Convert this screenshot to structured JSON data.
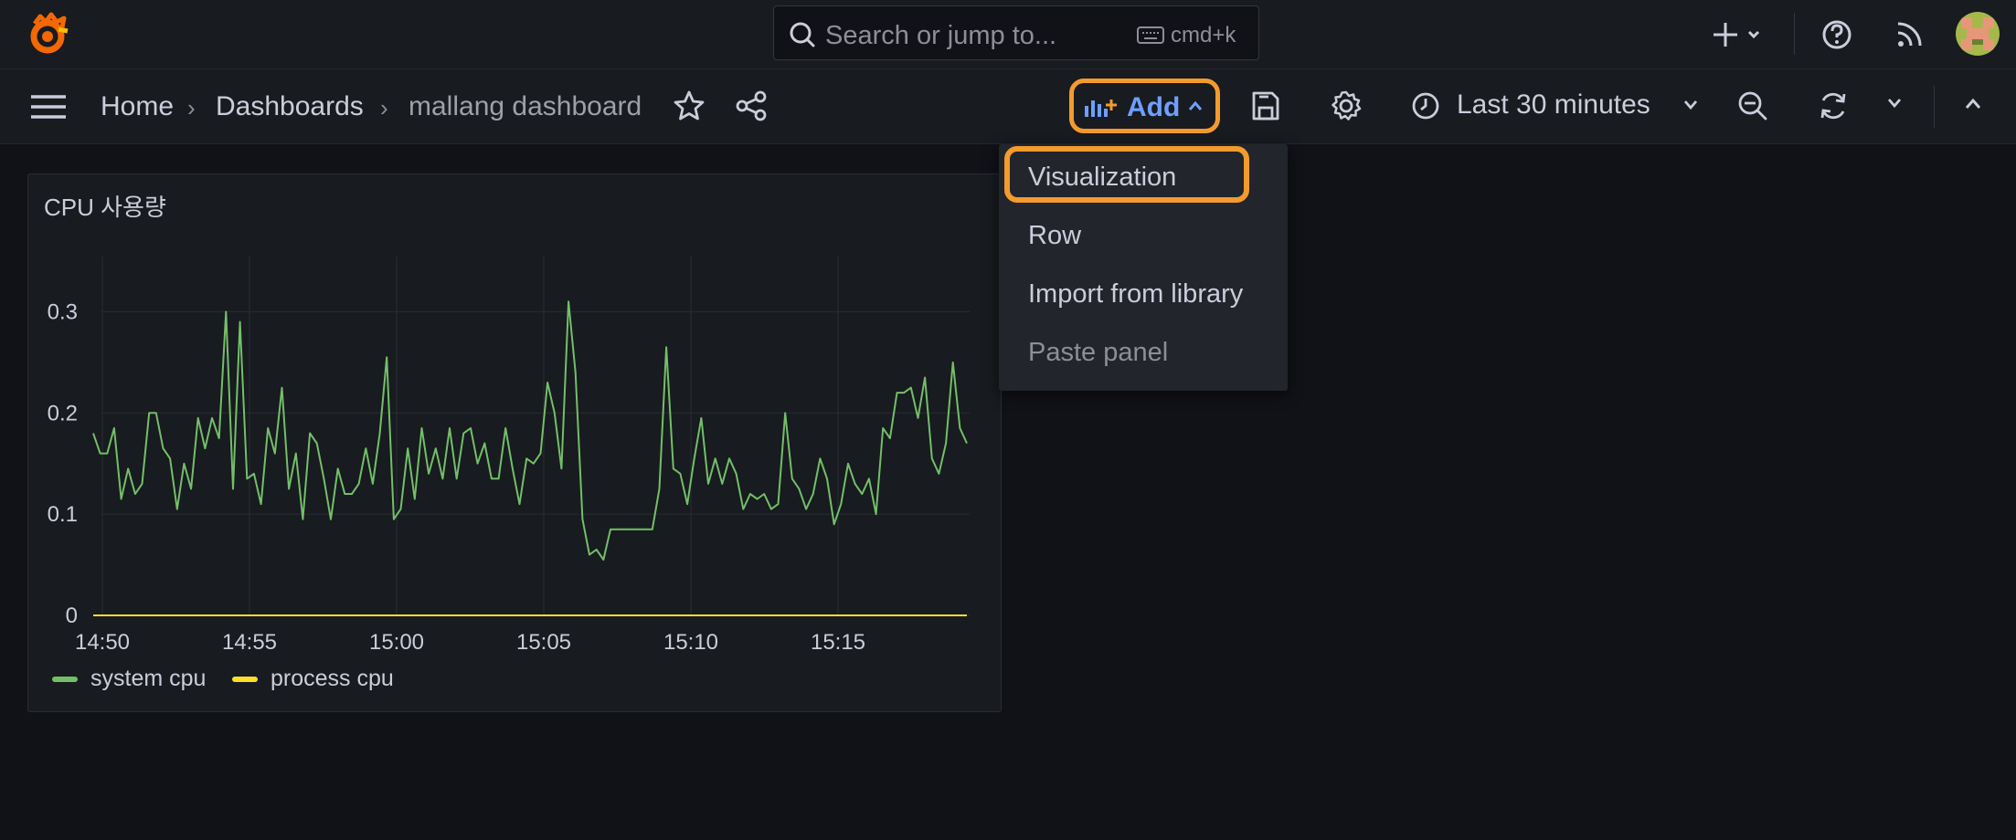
{
  "topbar": {
    "search_placeholder": "Search or jump to...",
    "search_shortcut": "cmd+k"
  },
  "breadcrumb": {
    "home": "Home",
    "separator": "›",
    "dashboards": "Dashboards",
    "current": "mallang dashboard"
  },
  "toolbar": {
    "add_label": "Add",
    "time_range": "Last 30 minutes"
  },
  "add_menu": {
    "items": [
      {
        "label": "Visualization",
        "disabled": false
      },
      {
        "label": "Row",
        "disabled": false
      },
      {
        "label": "Import from library",
        "disabled": false
      },
      {
        "label": "Paste panel",
        "disabled": true
      }
    ]
  },
  "colors": {
    "accent_highlight": "#f39b2c",
    "add_text": "#6e9fff",
    "system_cpu": "#73bf69",
    "process_cpu": "#fade2a"
  },
  "panel": {
    "title": "CPU 사용량"
  },
  "chart_data": {
    "type": "line",
    "title": "CPU 사용량",
    "x_ticks": [
      "14:50",
      "14:55",
      "15:00",
      "15:05",
      "15:10",
      "15:15"
    ],
    "y_ticks": [
      "0",
      "0.1",
      "0.2",
      "0.3"
    ],
    "ylim": [
      0,
      0.35
    ],
    "grid": true,
    "legend_position": "bottom-left",
    "series": [
      {
        "name": "system cpu",
        "color": "#73bf69",
        "values": [
          0.18,
          0.16,
          0.16,
          0.185,
          0.115,
          0.145,
          0.12,
          0.13,
          0.2,
          0.2,
          0.165,
          0.155,
          0.105,
          0.15,
          0.125,
          0.195,
          0.165,
          0.195,
          0.175,
          0.3,
          0.125,
          0.29,
          0.135,
          0.14,
          0.11,
          0.185,
          0.16,
          0.225,
          0.125,
          0.16,
          0.095,
          0.18,
          0.17,
          0.135,
          0.095,
          0.145,
          0.12,
          0.12,
          0.13,
          0.165,
          0.13,
          0.18,
          0.255,
          0.095,
          0.105,
          0.165,
          0.115,
          0.185,
          0.14,
          0.165,
          0.135,
          0.185,
          0.135,
          0.18,
          0.185,
          0.15,
          0.17,
          0.135,
          0.135,
          0.185,
          0.145,
          0.11,
          0.155,
          0.15,
          0.16,
          0.23,
          0.2,
          0.145,
          0.31,
          0.24,
          0.095,
          0.06,
          0.065,
          0.055,
          0.085,
          0.085,
          0.085,
          0.085,
          0.085,
          0.085,
          0.085,
          0.125,
          0.265,
          0.145,
          0.14,
          0.11,
          0.155,
          0.195,
          0.13,
          0.155,
          0.13,
          0.155,
          0.14,
          0.105,
          0.12,
          0.115,
          0.12,
          0.105,
          0.11,
          0.2,
          0.135,
          0.125,
          0.105,
          0.12,
          0.155,
          0.135,
          0.09,
          0.11,
          0.15,
          0.13,
          0.12,
          0.135,
          0.1,
          0.185,
          0.175,
          0.22,
          0.22,
          0.225,
          0.195,
          0.235,
          0.155,
          0.14,
          0.17,
          0.25,
          0.185,
          0.17
        ]
      },
      {
        "name": "process cpu",
        "color": "#fade2a",
        "values": [
          0,
          0,
          0,
          0,
          0,
          0,
          0,
          0,
          0,
          0,
          0,
          0,
          0,
          0,
          0,
          0,
          0,
          0,
          0,
          0,
          0,
          0,
          0,
          0,
          0,
          0,
          0,
          0,
          0,
          0,
          0,
          0,
          0,
          0,
          0,
          0,
          0,
          0,
          0,
          0,
          0,
          0,
          0,
          0,
          0,
          0,
          0,
          0,
          0,
          0,
          0,
          0,
          0,
          0,
          0,
          0,
          0,
          0,
          0,
          0,
          0,
          0,
          0,
          0,
          0,
          0,
          0,
          0,
          0,
          0,
          0,
          0,
          0,
          0,
          0,
          0,
          0,
          0,
          0,
          0,
          0,
          0,
          0,
          0,
          0,
          0,
          0,
          0,
          0,
          0,
          0,
          0,
          0,
          0,
          0,
          0,
          0,
          0,
          0,
          0,
          0,
          0,
          0,
          0,
          0,
          0,
          0,
          0,
          0,
          0,
          0,
          0,
          0,
          0,
          0,
          0,
          0,
          0,
          0,
          0,
          0,
          0,
          0,
          0,
          0,
          0
        ]
      }
    ]
  }
}
